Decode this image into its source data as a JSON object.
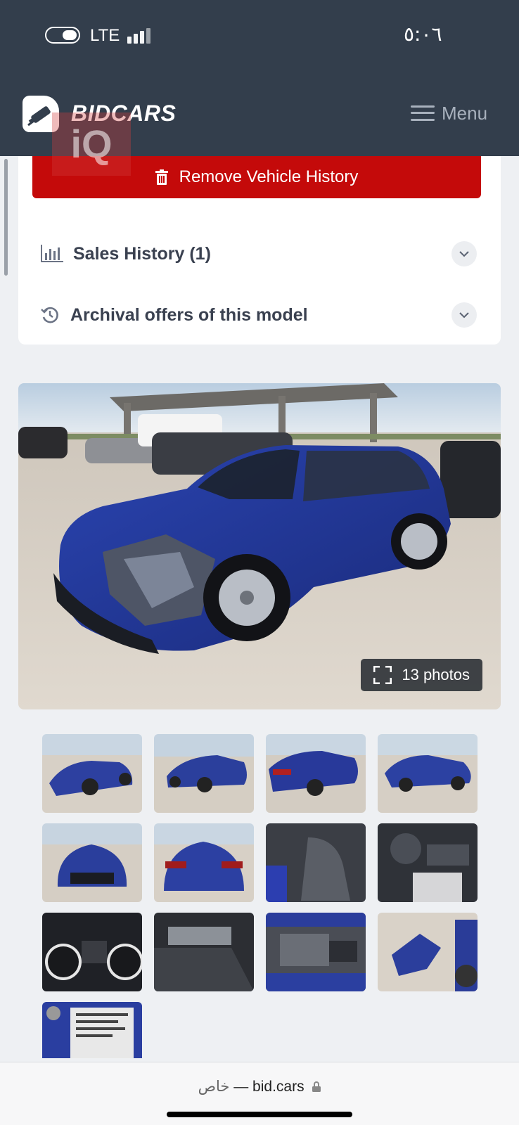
{
  "status_bar": {
    "network": "LTE",
    "time": "٥:٠٦"
  },
  "header": {
    "brand": "BIDCARS",
    "menu_label": "Menu",
    "watermark": "iQ"
  },
  "history_card": {
    "remove_button": "Remove Vehicle History",
    "sales_history": "Sales History (1)",
    "archival_offers": "Archival offers of this model"
  },
  "gallery": {
    "photo_count_label": "13 photos",
    "thumbnails": [
      "exterior-front-left",
      "exterior-rear-left",
      "exterior-rear-left-close",
      "exterior-right-side",
      "exterior-front",
      "exterior-rear",
      "interior-front-seats",
      "interior-dashboard",
      "instrument-cluster",
      "interior-rear-seats",
      "engine-bay",
      "damaged-parts",
      "vin-label"
    ]
  },
  "url_bar": {
    "private_label": "خاص",
    "separator": "—",
    "domain": "bid.cars"
  },
  "colors": {
    "header_bg": "#333e4c",
    "danger": "#c40a0a",
    "car_blue": "#23389a"
  }
}
